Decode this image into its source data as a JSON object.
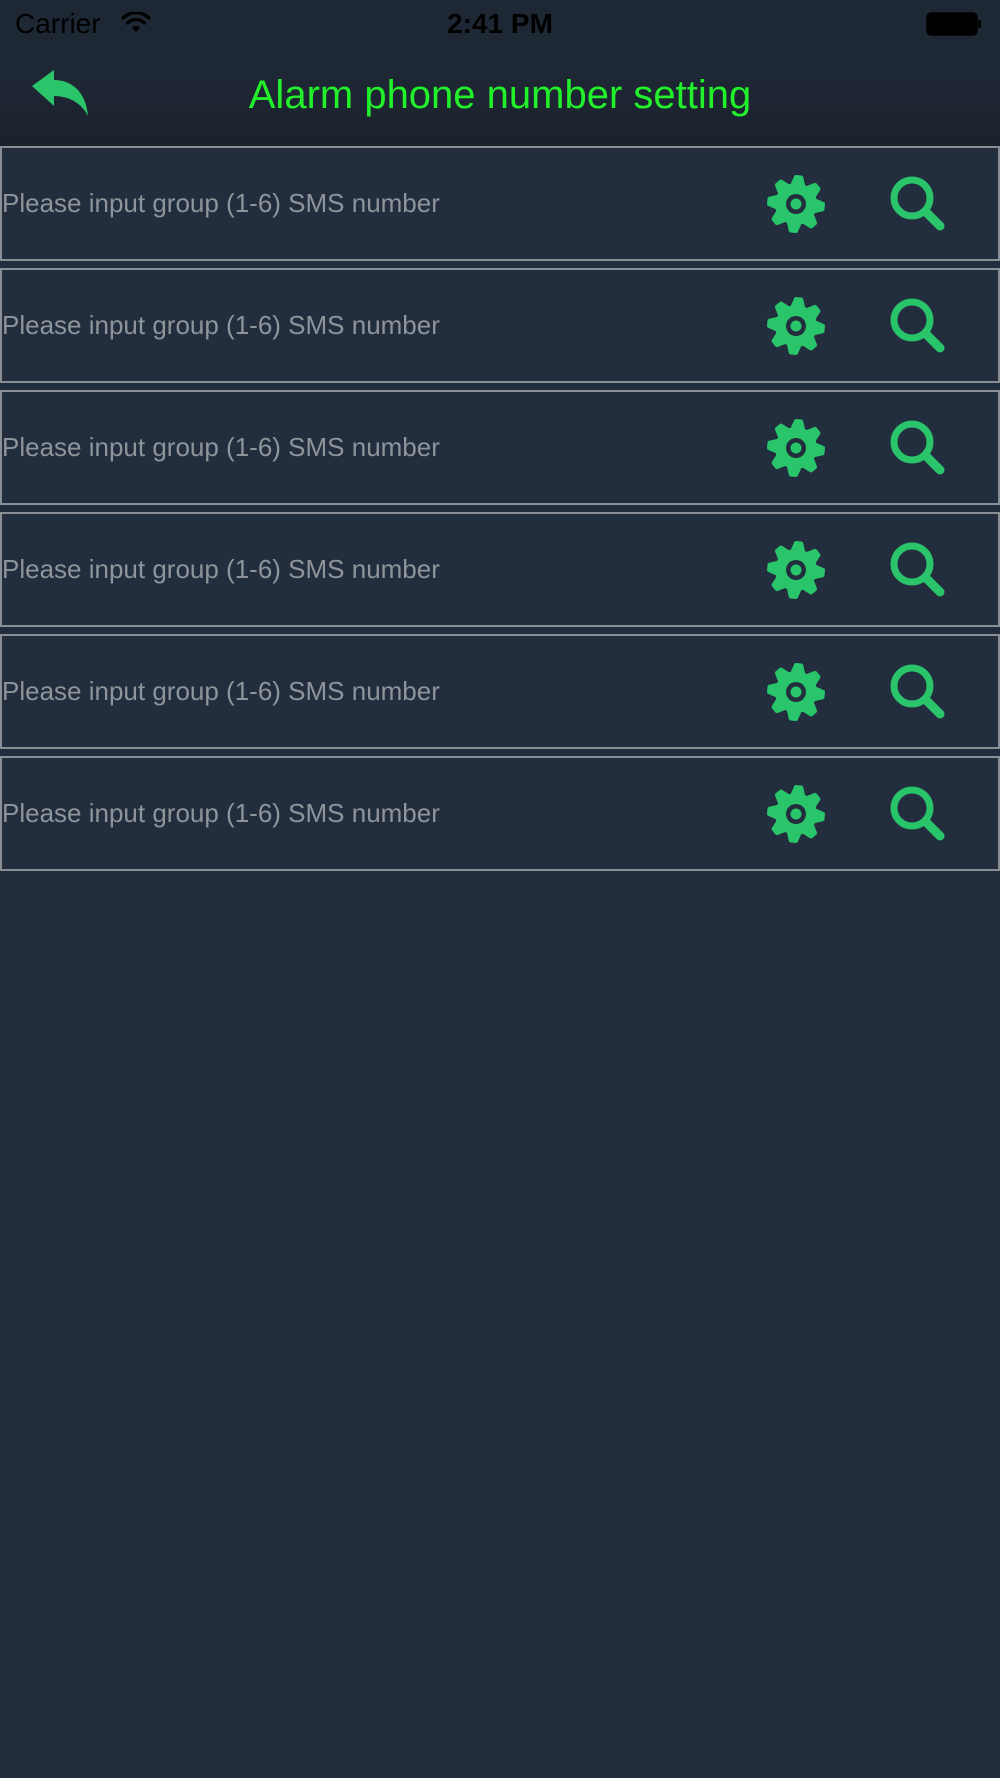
{
  "status_bar": {
    "carrier": "Carrier",
    "time": "2:41 PM"
  },
  "header": {
    "title": "Alarm phone number setting",
    "back_icon": "back-arrow-icon"
  },
  "colors": {
    "accent": "#2ac46a",
    "title": "#22f02a",
    "background": "#212d3d"
  },
  "rows": [
    {
      "placeholder": "Please input group (1-6) SMS number",
      "value": ""
    },
    {
      "placeholder": "Please input group (1-6) SMS number",
      "value": ""
    },
    {
      "placeholder": "Please input group (1-6) SMS number",
      "value": ""
    },
    {
      "placeholder": "Please input group (1-6) SMS number",
      "value": ""
    },
    {
      "placeholder": "Please input group (1-6) SMS number",
      "value": ""
    },
    {
      "placeholder": "Please input group (1-6) SMS number",
      "value": ""
    }
  ],
  "icons": {
    "set": "gear-icon",
    "query": "search-icon"
  }
}
